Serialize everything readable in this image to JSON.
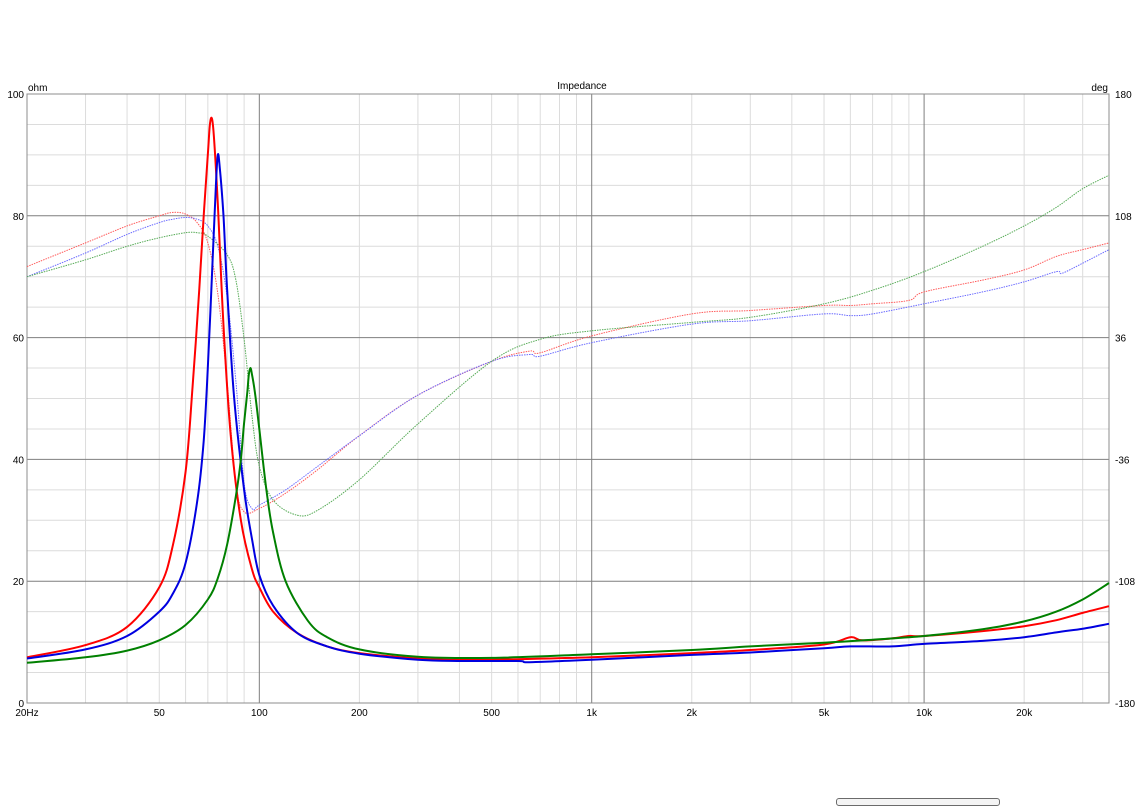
{
  "chart_data": {
    "type": "line",
    "title": "Impedance",
    "ylabel": "ohm",
    "y2label": "deg",
    "xscale": "log",
    "xlim": [
      20,
      36000
    ],
    "ylim": [
      0,
      100
    ],
    "y2lim": [
      -180,
      180
    ],
    "grid": true,
    "x_ticks": [
      {
        "value": 20,
        "label": "20Hz"
      },
      {
        "value": 50,
        "label": "50"
      },
      {
        "value": 100,
        "label": "100"
      },
      {
        "value": 200,
        "label": "200"
      },
      {
        "value": 500,
        "label": "500"
      },
      {
        "value": 1000,
        "label": "1k"
      },
      {
        "value": 2000,
        "label": "2k"
      },
      {
        "value": 5000,
        "label": "5k"
      },
      {
        "value": 10000,
        "label": "10k"
      },
      {
        "value": 20000,
        "label": "20k"
      }
    ],
    "y_ticks": [
      0,
      20,
      40,
      60,
      80,
      100
    ],
    "y2_ticks": [
      -180,
      -108,
      -36,
      36,
      108,
      180
    ],
    "series": [
      {
        "color": "#ff0000",
        "kind": "impedance",
        "points": [
          [
            20,
            7.5
          ],
          [
            30,
            9.5
          ],
          [
            40,
            12.5
          ],
          [
            50,
            19
          ],
          [
            55,
            26
          ],
          [
            60,
            38
          ],
          [
            63,
            52
          ],
          [
            66,
            68
          ],
          [
            68,
            80
          ],
          [
            70,
            90
          ],
          [
            71,
            95
          ],
          [
            72,
            96
          ],
          [
            73,
            93
          ],
          [
            75,
            82
          ],
          [
            78,
            62
          ],
          [
            82,
            44
          ],
          [
            88,
            30
          ],
          [
            95,
            22
          ],
          [
            100,
            19
          ],
          [
            110,
            15
          ],
          [
            130,
            11.5
          ],
          [
            160,
            9.3
          ],
          [
            200,
            8.2
          ],
          [
            300,
            7.3
          ],
          [
            400,
            7.1
          ],
          [
            600,
            7.2
          ],
          [
            1000,
            7.5
          ],
          [
            2000,
            8.2
          ],
          [
            3000,
            8.7
          ],
          [
            5000,
            9.6
          ],
          [
            6000,
            10.8
          ],
          [
            6500,
            10.3
          ],
          [
            8000,
            10.6
          ],
          [
            9000,
            11
          ],
          [
            10000,
            11
          ],
          [
            15000,
            11.8
          ],
          [
            20000,
            12.6
          ],
          [
            25000,
            13.6
          ],
          [
            30000,
            14.8
          ],
          [
            36000,
            15.9
          ]
        ]
      },
      {
        "color": "#0000e0",
        "kind": "impedance",
        "points": [
          [
            20,
            7.3
          ],
          [
            30,
            8.8
          ],
          [
            40,
            11
          ],
          [
            50,
            15
          ],
          [
            55,
            18
          ],
          [
            60,
            23
          ],
          [
            65,
            33
          ],
          [
            68,
            43
          ],
          [
            70,
            55
          ],
          [
            72,
            70
          ],
          [
            74,
            85
          ],
          [
            75,
            90
          ],
          [
            76,
            88
          ],
          [
            78,
            80
          ],
          [
            80,
            68
          ],
          [
            84,
            50
          ],
          [
            90,
            35
          ],
          [
            95,
            27
          ],
          [
            100,
            21
          ],
          [
            110,
            16
          ],
          [
            130,
            11.5
          ],
          [
            160,
            9.3
          ],
          [
            200,
            8.1
          ],
          [
            300,
            7.1
          ],
          [
            400,
            6.9
          ],
          [
            600,
            6.9
          ],
          [
            650,
            6.7
          ],
          [
            1000,
            7.1
          ],
          [
            2000,
            7.9
          ],
          [
            3000,
            8.3
          ],
          [
            5000,
            9
          ],
          [
            6000,
            9.3
          ],
          [
            8000,
            9.3
          ],
          [
            10000,
            9.7
          ],
          [
            15000,
            10.2
          ],
          [
            20000,
            10.8
          ],
          [
            25000,
            11.6
          ],
          [
            30000,
            12.2
          ],
          [
            36000,
            13
          ]
        ]
      },
      {
        "color": "#008000",
        "kind": "impedance",
        "points": [
          [
            20,
            6.6
          ],
          [
            30,
            7.5
          ],
          [
            40,
            8.6
          ],
          [
            50,
            10.3
          ],
          [
            60,
            12.8
          ],
          [
            70,
            17
          ],
          [
            75,
            20.5
          ],
          [
            80,
            26
          ],
          [
            85,
            34
          ],
          [
            88,
            40
          ],
          [
            90,
            46
          ],
          [
            92,
            51
          ],
          [
            93,
            54
          ],
          [
            94,
            55
          ],
          [
            95,
            54
          ],
          [
            97,
            51
          ],
          [
            100,
            45
          ],
          [
            105,
            35
          ],
          [
            110,
            28
          ],
          [
            120,
            20
          ],
          [
            140,
            13.5
          ],
          [
            160,
            10.8
          ],
          [
            200,
            8.8
          ],
          [
            300,
            7.6
          ],
          [
            500,
            7.4
          ],
          [
            1000,
            8
          ],
          [
            2000,
            8.7
          ],
          [
            3000,
            9.3
          ],
          [
            5000,
            9.9
          ],
          [
            7000,
            10.4
          ],
          [
            10000,
            11
          ],
          [
            15000,
            12.1
          ],
          [
            20000,
            13.4
          ],
          [
            25000,
            15
          ],
          [
            30000,
            17
          ],
          [
            36000,
            19.7
          ]
        ]
      },
      {
        "color": "#ff5a5a",
        "kind": "phase",
        "points": [
          [
            20,
            78
          ],
          [
            30,
            92
          ],
          [
            40,
            102
          ],
          [
            50,
            108
          ],
          [
            55,
            110
          ],
          [
            60,
            109
          ],
          [
            65,
            104
          ],
          [
            70,
            92
          ],
          [
            75,
            62
          ],
          [
            80,
            10
          ],
          [
            85,
            -50
          ],
          [
            90,
            -67
          ],
          [
            100,
            -65
          ],
          [
            120,
            -56
          ],
          [
            150,
            -42
          ],
          [
            200,
            -22
          ],
          [
            300,
            2
          ],
          [
            500,
            22
          ],
          [
            650,
            28
          ],
          [
            700,
            27
          ],
          [
            1000,
            37
          ],
          [
            2000,
            50
          ],
          [
            3000,
            52
          ],
          [
            5000,
            55
          ],
          [
            6000,
            55
          ],
          [
            7000,
            56
          ],
          [
            9000,
            58
          ],
          [
            10000,
            63
          ],
          [
            15000,
            70
          ],
          [
            20000,
            76
          ],
          [
            25000,
            84
          ],
          [
            30000,
            88
          ],
          [
            36000,
            92
          ]
        ]
      },
      {
        "color": "#6a6aff",
        "kind": "phase",
        "points": [
          [
            20,
            72
          ],
          [
            30,
            86
          ],
          [
            40,
            97
          ],
          [
            50,
            104
          ],
          [
            55,
            106
          ],
          [
            60,
            107
          ],
          [
            65,
            106
          ],
          [
            70,
            102
          ],
          [
            75,
            90
          ],
          [
            80,
            60
          ],
          [
            85,
            10
          ],
          [
            90,
            -50
          ],
          [
            95,
            -65
          ],
          [
            100,
            -63
          ],
          [
            120,
            -54
          ],
          [
            150,
            -40
          ],
          [
            200,
            -22
          ],
          [
            300,
            2
          ],
          [
            500,
            22
          ],
          [
            650,
            26
          ],
          [
            700,
            25
          ],
          [
            1000,
            33
          ],
          [
            2000,
            44
          ],
          [
            3000,
            46
          ],
          [
            5000,
            50
          ],
          [
            6000,
            49
          ],
          [
            7000,
            50
          ],
          [
            10000,
            56
          ],
          [
            15000,
            63
          ],
          [
            20000,
            69
          ],
          [
            25000,
            75
          ],
          [
            26000,
            74
          ],
          [
            30000,
            80
          ],
          [
            36000,
            88
          ]
        ]
      },
      {
        "color": "#55aa55",
        "kind": "phase",
        "points": [
          [
            20,
            72
          ],
          [
            30,
            82
          ],
          [
            40,
            90
          ],
          [
            50,
            95
          ],
          [
            60,
            98
          ],
          [
            65,
            98
          ],
          [
            70,
            96
          ],
          [
            80,
            85
          ],
          [
            85,
            70
          ],
          [
            90,
            35
          ],
          [
            95,
            -10
          ],
          [
            100,
            -40
          ],
          [
            110,
            -60
          ],
          [
            130,
            -69
          ],
          [
            150,
            -66
          ],
          [
            200,
            -48
          ],
          [
            300,
            -15
          ],
          [
            500,
            22
          ],
          [
            700,
            35
          ],
          [
            1000,
            40
          ],
          [
            2000,
            45
          ],
          [
            3000,
            48
          ],
          [
            5000,
            56
          ],
          [
            7000,
            64
          ],
          [
            10000,
            75
          ],
          [
            15000,
            90
          ],
          [
            20000,
            102
          ],
          [
            25000,
            113
          ],
          [
            30000,
            124
          ],
          [
            36000,
            132
          ]
        ]
      }
    ]
  }
}
